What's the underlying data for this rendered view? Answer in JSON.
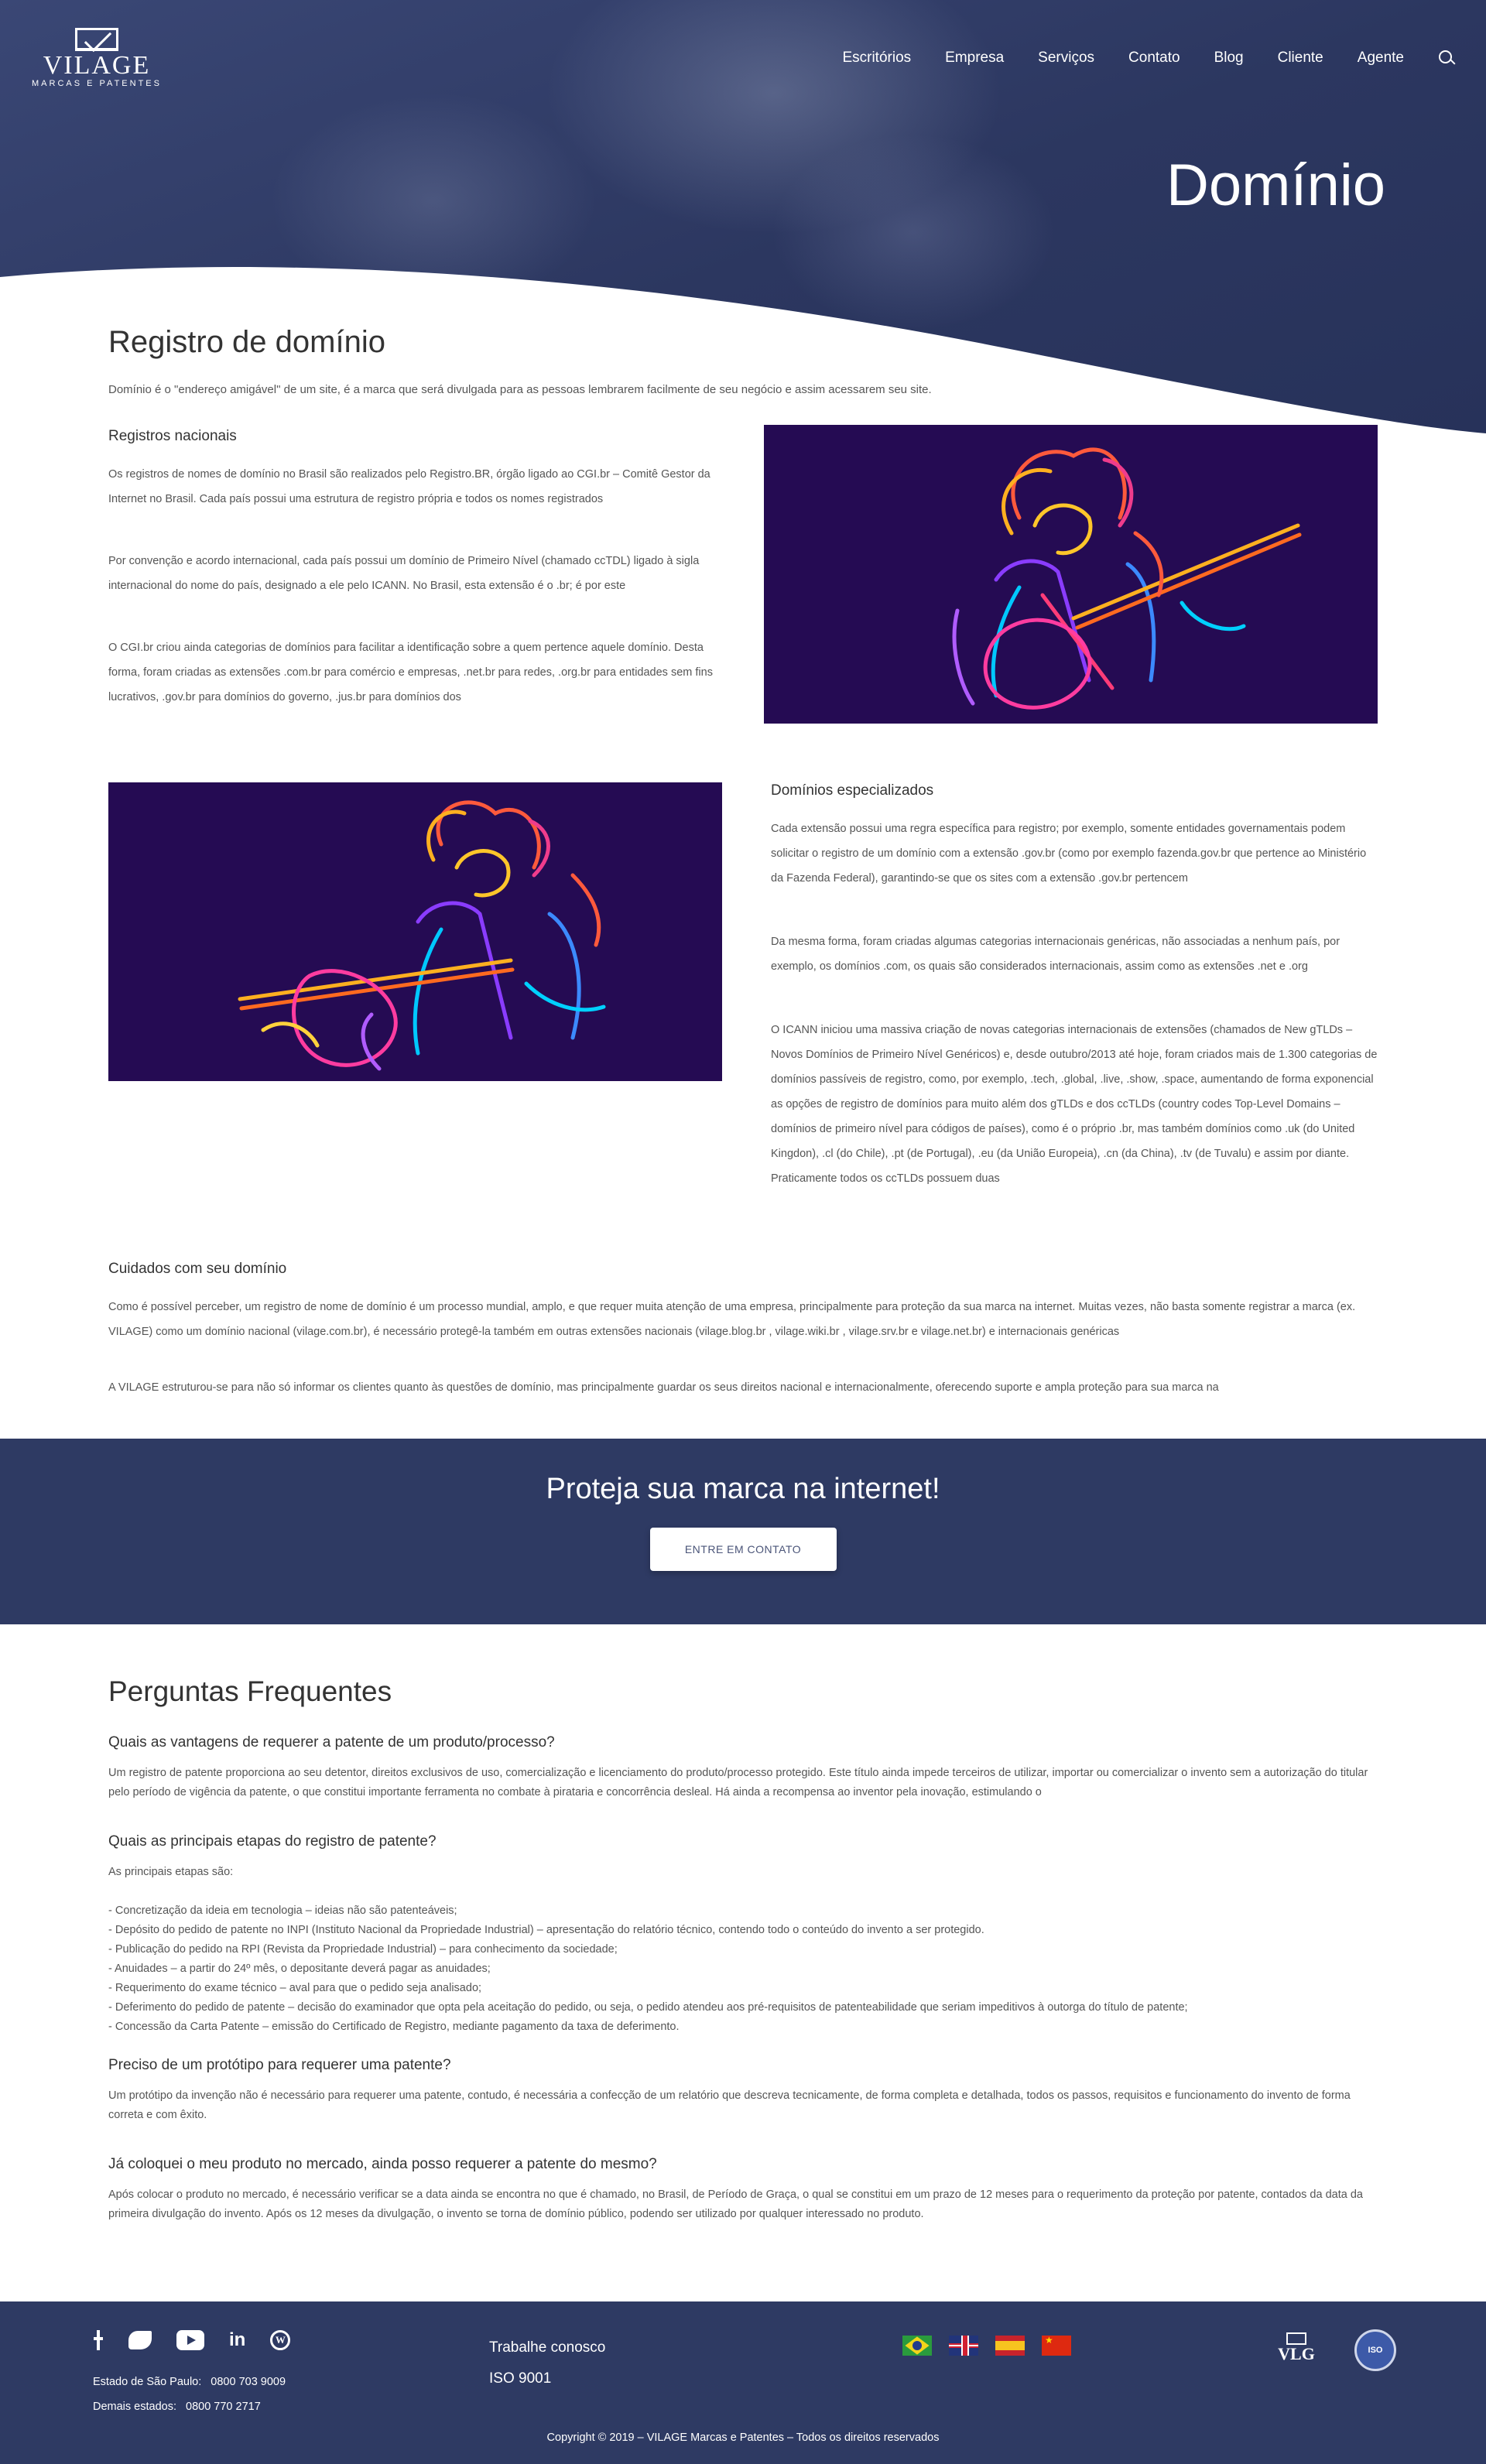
{
  "header": {
    "logo_name": "VILAGE",
    "logo_tagline": "MARCAS E PATENTES",
    "nav": [
      "Escritórios",
      "Empresa",
      "Serviços",
      "Contato",
      "Blog",
      "Cliente",
      "Agente"
    ],
    "page_title": "Domínio"
  },
  "intro": {
    "title": "Registro de domínio",
    "text": "Domínio é o \"endereço amigável\" de um site, é a marca que será divulgada para as pessoas lembrarem facilmente de seu negócio e assim acessarem seu site."
  },
  "nacionais": {
    "heading": "Registros nacionais",
    "p1": "Os registros de nomes de domínio no Brasil são realizados pelo Registro.BR, órgão ligado ao CGI.br – Comitê Gestor da Internet no Brasil. Cada país possui uma estrutura de registro própria e todos os nomes registrados",
    "p2": "Por convenção e acordo internacional, cada país possui um domínio de Primeiro Nível (chamado ccTDL) ligado à sigla internacional do nome do país, designado a ele pelo ICANN. No Brasil, esta extensão é o .br; é por este",
    "p3": "O CGI.br criou ainda categorias de domínios para facilitar a identificação sobre a quem pertence aquele domínio. Desta forma, foram criadas as extensões .com.br para comércio e empresas, .net.br para redes, .org.br para entidades sem fins lucrativos, .gov.br para domínios do governo, .jus.br para domínios dos"
  },
  "especializados": {
    "heading": "Domínios especializados",
    "p1": "Cada extensão possui uma regra específica para registro; por exemplo, somente entidades governamentais podem solicitar o registro de um domínio com a extensão .gov.br (como por exemplo fazenda.gov.br que pertence ao Ministério da Fazenda Federal), garantindo-se  que os sites com a extensão .gov.br  pertencem",
    "p2": "Da mesma forma, foram criadas algumas categorias internacionais genéricas, não associadas a nenhum país, por exemplo, os domínios .com, os quais são considerados internacionais, assim como as extensões .net e .org",
    "p3": "O ICANN iniciou uma massiva criação de novas categorias internacionais de extensões (chamados de New gTLDs – Novos Domínios de Primeiro Nível Genéricos) e, desde outubro/2013 até hoje, foram criados mais de 1.300 categorias de domínios passíveis de registro, como, por exemplo, .tech, .global, .live, .show, .space, aumentando de forma exponencial as opções de registro de domínios para muito além dos gTLDs e dos ccTLDs (country codes Top-Level Domains – domínios de primeiro nível para códigos de países), como é o próprio .br, mas também domínios como .uk (do United Kingdon), .cl (do Chile), .pt (de Portugal), .eu (da União Europeia), .cn (da China), .tv (de Tuvalu) e assim por diante. Praticamente todos os ccTLDs possuem duas"
  },
  "cuidados": {
    "heading": "Cuidados com seu domínio",
    "p1": "Como é possível perceber, um registro de nome de domínio é um processo mundial, amplo, e que requer muita atenção de uma empresa, principalmente para proteção da sua marca na internet. Muitas vezes, não basta somente registrar a marca (ex. VILAGE) como um domínio nacional (vilage.com.br), é necessário protegê-la também em outras extensões nacionais (vilage.blog.br , vilage.wiki.br , vilage.srv.br e vilage.net.br) e internacionais genéricas",
    "p2": "A VILAGE estruturou-se para não só informar os clientes quanto às questões de domínio, mas principalmente guardar os seus direitos nacional e internacionalmente, oferecendo suporte e ampla proteção para sua marca na"
  },
  "cta": {
    "title": "Proteja sua marca na internet!",
    "button": "ENTRE EM CONTATO"
  },
  "faq": {
    "title": "Perguntas Frequentes",
    "q1": "Quais as vantagens de requerer a patente de um produto/processo?",
    "a1": "Um registro de patente proporciona ao seu detentor, direitos exclusivos de uso, comercialização e licenciamento do produto/processo protegido. Este título ainda impede terceiros de utilizar, importar ou comercializar o invento sem a autorização do titular pelo período de vigência da patente, o que constitui importante ferramenta no combate à pirataria e concorrência desleal. Há ainda a recompensa ao inventor pela inovação, estimulando o",
    "q2": "Quais as principais etapas do registro de patente?",
    "a2_lines": [
      "As principais etapas são:",
      "",
      "- Concretização da ideia em tecnologia – ideias não são patenteáveis;",
      "- Depósito do pedido de patente no INPI (Instituto Nacional da Propriedade Industrial) – apresentação do relatório técnico, contendo todo o conteúdo do invento a ser protegido.",
      "- Publicação do pedido na RPI (Revista da Propriedade Industrial) – para conhecimento da sociedade;",
      "- Anuidades – a partir do 24º mês, o depositante deverá pagar as anuidades;",
      "- Requerimento do exame técnico – aval para que o pedido seja analisado;",
      "- Deferimento do pedido de patente – decisão do examinador que opta pela aceitação do pedido, ou seja, o pedido atendeu aos pré-requisitos de patenteabilidade que seriam impeditivos à outorga do título de patente;",
      "- Concessão da Carta Patente – emissão do Certificado de Registro, mediante pagamento da taxa de deferimento."
    ],
    "q3": "Preciso de um protótipo para requerer uma patente?",
    "a3": "Um protótipo da invenção não é necessário para requerer uma patente, contudo, é necessária a confecção de um relatório que descreva tecnicamente, de forma completa e detalhada, todos os passos, requisitos e funcionamento do invento de forma correta e com êxito.",
    "q4": "Já coloquei o meu produto no mercado, ainda posso requerer a patente do mesmo?",
    "a4": "Após colocar o produto no mercado, é necessário verificar se a data ainda se encontra no que é chamado, no Brasil, de Período de Graça, o qual se constitui em um prazo de 12 meses para o requerimento da proteção por patente, contados da data da primeira divulgação do invento. Após os 12 meses da divulgação, o invento se torna de domínio público, podendo ser utilizado por qualquer interessado no produto."
  },
  "footer": {
    "social_icons": [
      "facebook-icon",
      "twitter-icon",
      "youtube-icon",
      "linkedin-icon",
      "wordpress-icon"
    ],
    "sp_label": "Estado de São Paulo:",
    "sp_phone": "0800 703 9009",
    "other_label": "Demais estados:",
    "other_phone": "0800 770 2717",
    "link1": "Trabalhe conosco",
    "link2": "ISO 9001",
    "vlg": "VLG",
    "iso_badge": "ISO",
    "copyright": "Copyright © 2019 – VILAGE Marcas e Patentes – Todos os direitos reservados"
  }
}
